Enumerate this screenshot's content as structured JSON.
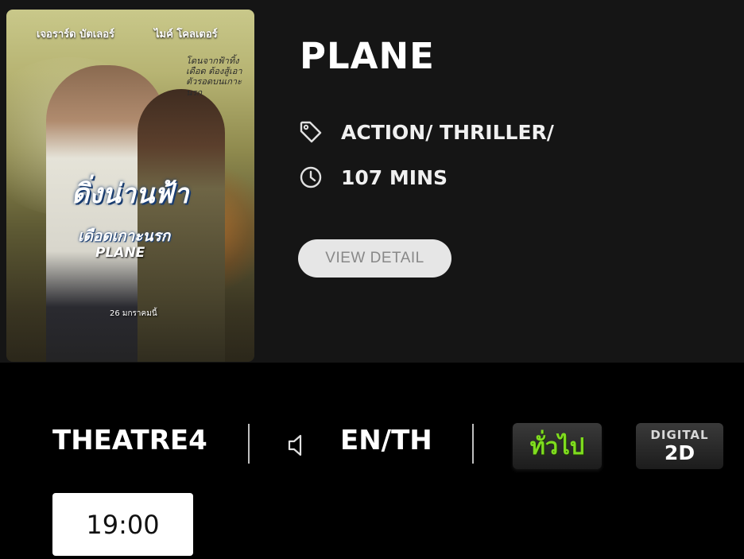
{
  "movie": {
    "title": "PLANE",
    "genre": "ACTION/ THRILLER/",
    "duration": "107 MINS",
    "view_detail_label": "VIEW DETAIL"
  },
  "poster": {
    "actor_1": "เจอราร์ด บัตเลอร์",
    "actor_2": "ไมค์ โคลเตอร์",
    "tagline": "โดนจากฟ้าทิ้งเดือด ต้องสู้เอาตัวรอดบนเกาะนรก",
    "title_th_line1": "ดิ่งน่านฟ้า",
    "title_th_line2": "เดือดเกาะนรก",
    "title_en": "PLANE",
    "release_date": "26 มกราคมนี้"
  },
  "showtime": {
    "theatre": "THEATRE4",
    "language": "EN/TH",
    "rating_label": "ทั่วไป",
    "format_top": "DIGITAL",
    "format_bottom": "2D",
    "times": [
      "19:00"
    ]
  },
  "icons": {
    "genre": "tag-icon",
    "duration": "clock-icon",
    "language": "speaker-icon"
  },
  "colors": {
    "background": "#000000",
    "card": "#151515",
    "rating_green": "#7fdc1f"
  }
}
